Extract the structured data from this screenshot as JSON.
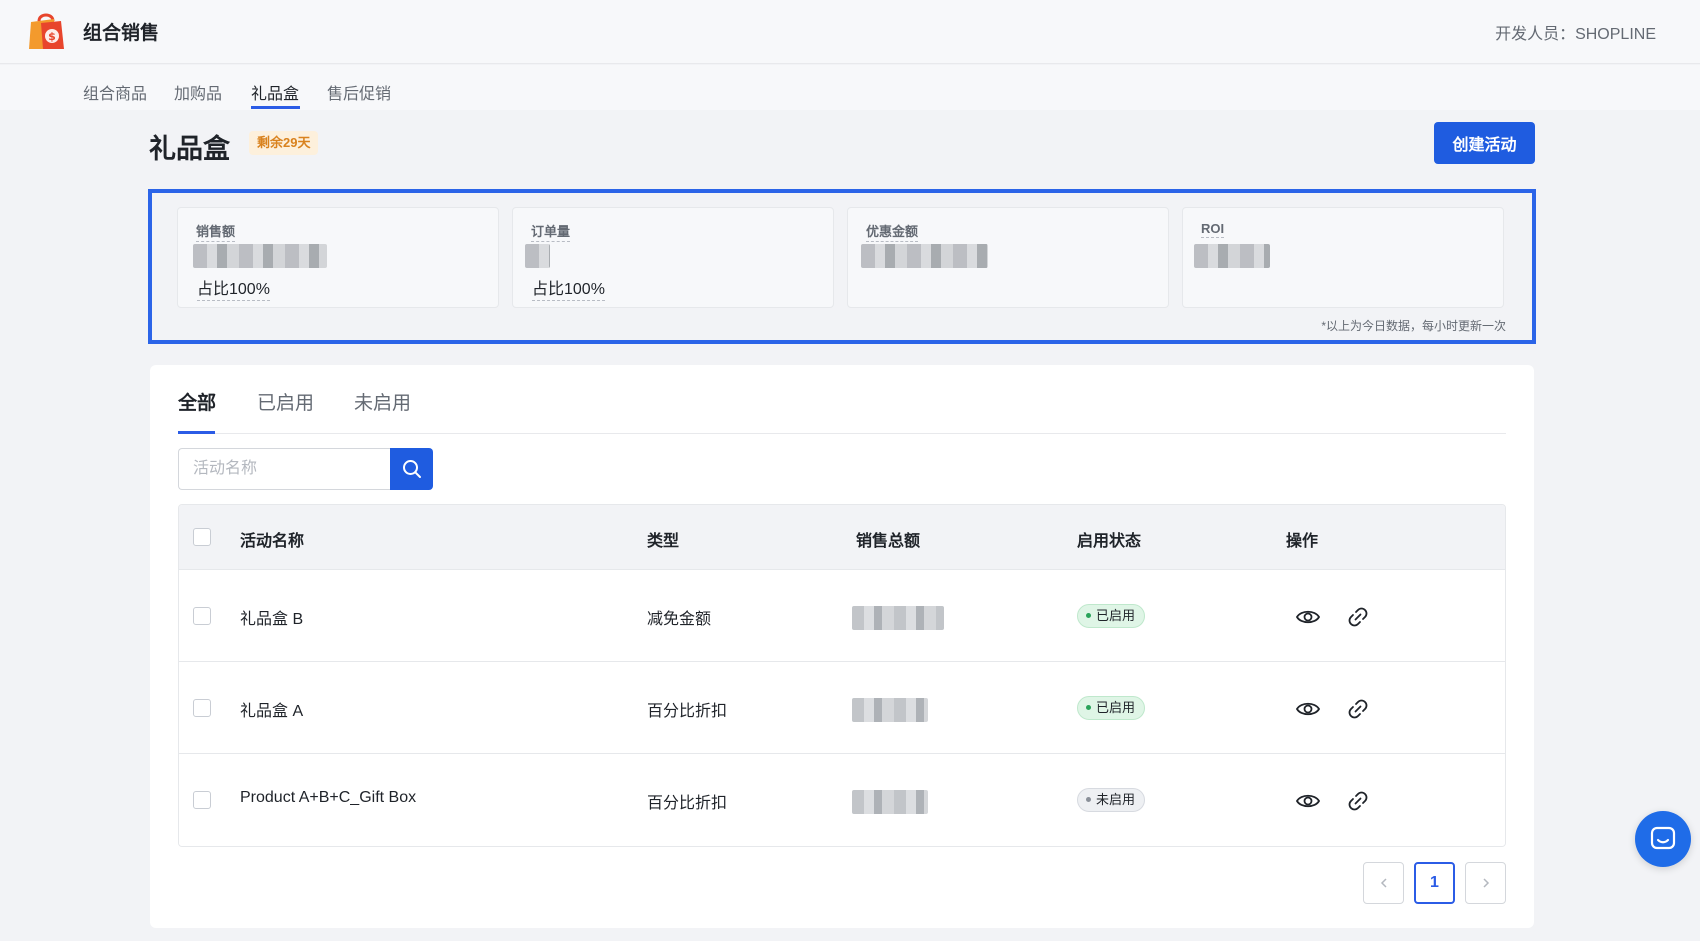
{
  "app": {
    "title": "组合销售",
    "developer": "开发人员：SHOPLINE"
  },
  "subnav": {
    "items": [
      "组合商品",
      "加购品",
      "礼品盒",
      "售后促销"
    ],
    "active_index": 2
  },
  "page": {
    "title": "礼品盒",
    "badge": "剩余29天",
    "create_button": "创建活动"
  },
  "stats": {
    "cards": [
      {
        "label": "销售额",
        "share": "占比100%"
      },
      {
        "label": "订单量",
        "share": "占比100%"
      },
      {
        "label": "优惠金额",
        "share": ""
      },
      {
        "label": "ROI",
        "share": ""
      }
    ],
    "note": "*以上为今日数据，每小时更新一次"
  },
  "tabs": {
    "items": [
      "全部",
      "已启用",
      "未启用"
    ],
    "active_index": 0
  },
  "search": {
    "placeholder": "活动名称"
  },
  "table": {
    "headers": [
      "活动名称",
      "类型",
      "销售总额",
      "启用状态",
      "操作"
    ],
    "rows": [
      {
        "name": "礼品盒 B",
        "type": "减免金额",
        "status": "已启用"
      },
      {
        "name": "礼品盒 A",
        "type": "百分比折扣",
        "status": "已启用"
      },
      {
        "name": "Product A+B+C_Gift Box",
        "type": "百分比折扣",
        "status": "未启用"
      }
    ]
  },
  "pagination": {
    "current_page": "1"
  },
  "colors": {
    "primary": "#1f5ce0",
    "enabled_bg": "#dff5e6",
    "badge_bg": "#fdf0dc",
    "badge_text": "#d9821e"
  }
}
